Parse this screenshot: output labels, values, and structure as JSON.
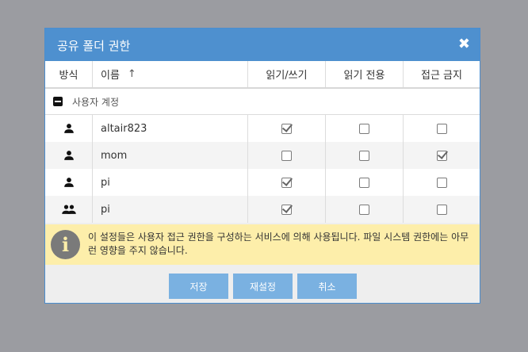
{
  "dialog": {
    "title": "공유 폴더 권한",
    "close_glyph": "✖"
  },
  "table": {
    "headers": {
      "mode": "방식",
      "name": "이름",
      "name_sort_glyph": "↑",
      "read_write": "읽기/쓰기",
      "read_only": "읽기 전용",
      "no_access": "접근 금지"
    },
    "group_label": "사용자 계정",
    "rows": [
      {
        "type": "user-icon",
        "name": "altair823",
        "read_write": true,
        "read_only": false,
        "no_access": false
      },
      {
        "type": "user-icon",
        "name": "mom",
        "read_write": false,
        "read_only": false,
        "no_access": true
      },
      {
        "type": "user-icon",
        "name": "pi",
        "read_write": true,
        "read_only": false,
        "no_access": false
      },
      {
        "type": "group-icon",
        "name": "pi",
        "read_write": true,
        "read_only": false,
        "no_access": false
      }
    ]
  },
  "info": {
    "icon": "info-icon",
    "text": "이 설정들은 사용자 접근 권한을 구성하는 서비스에 의해 사용됩니다. 파일 시스템 권한에는 아무런 영향을 주지 않습니다."
  },
  "buttons": {
    "save": "저장",
    "reset": "재설정",
    "cancel": "취소"
  },
  "colors": {
    "title_bar": "#4e90cf",
    "button": "#7ab1e1",
    "info_bg": "#fdeeaa"
  }
}
